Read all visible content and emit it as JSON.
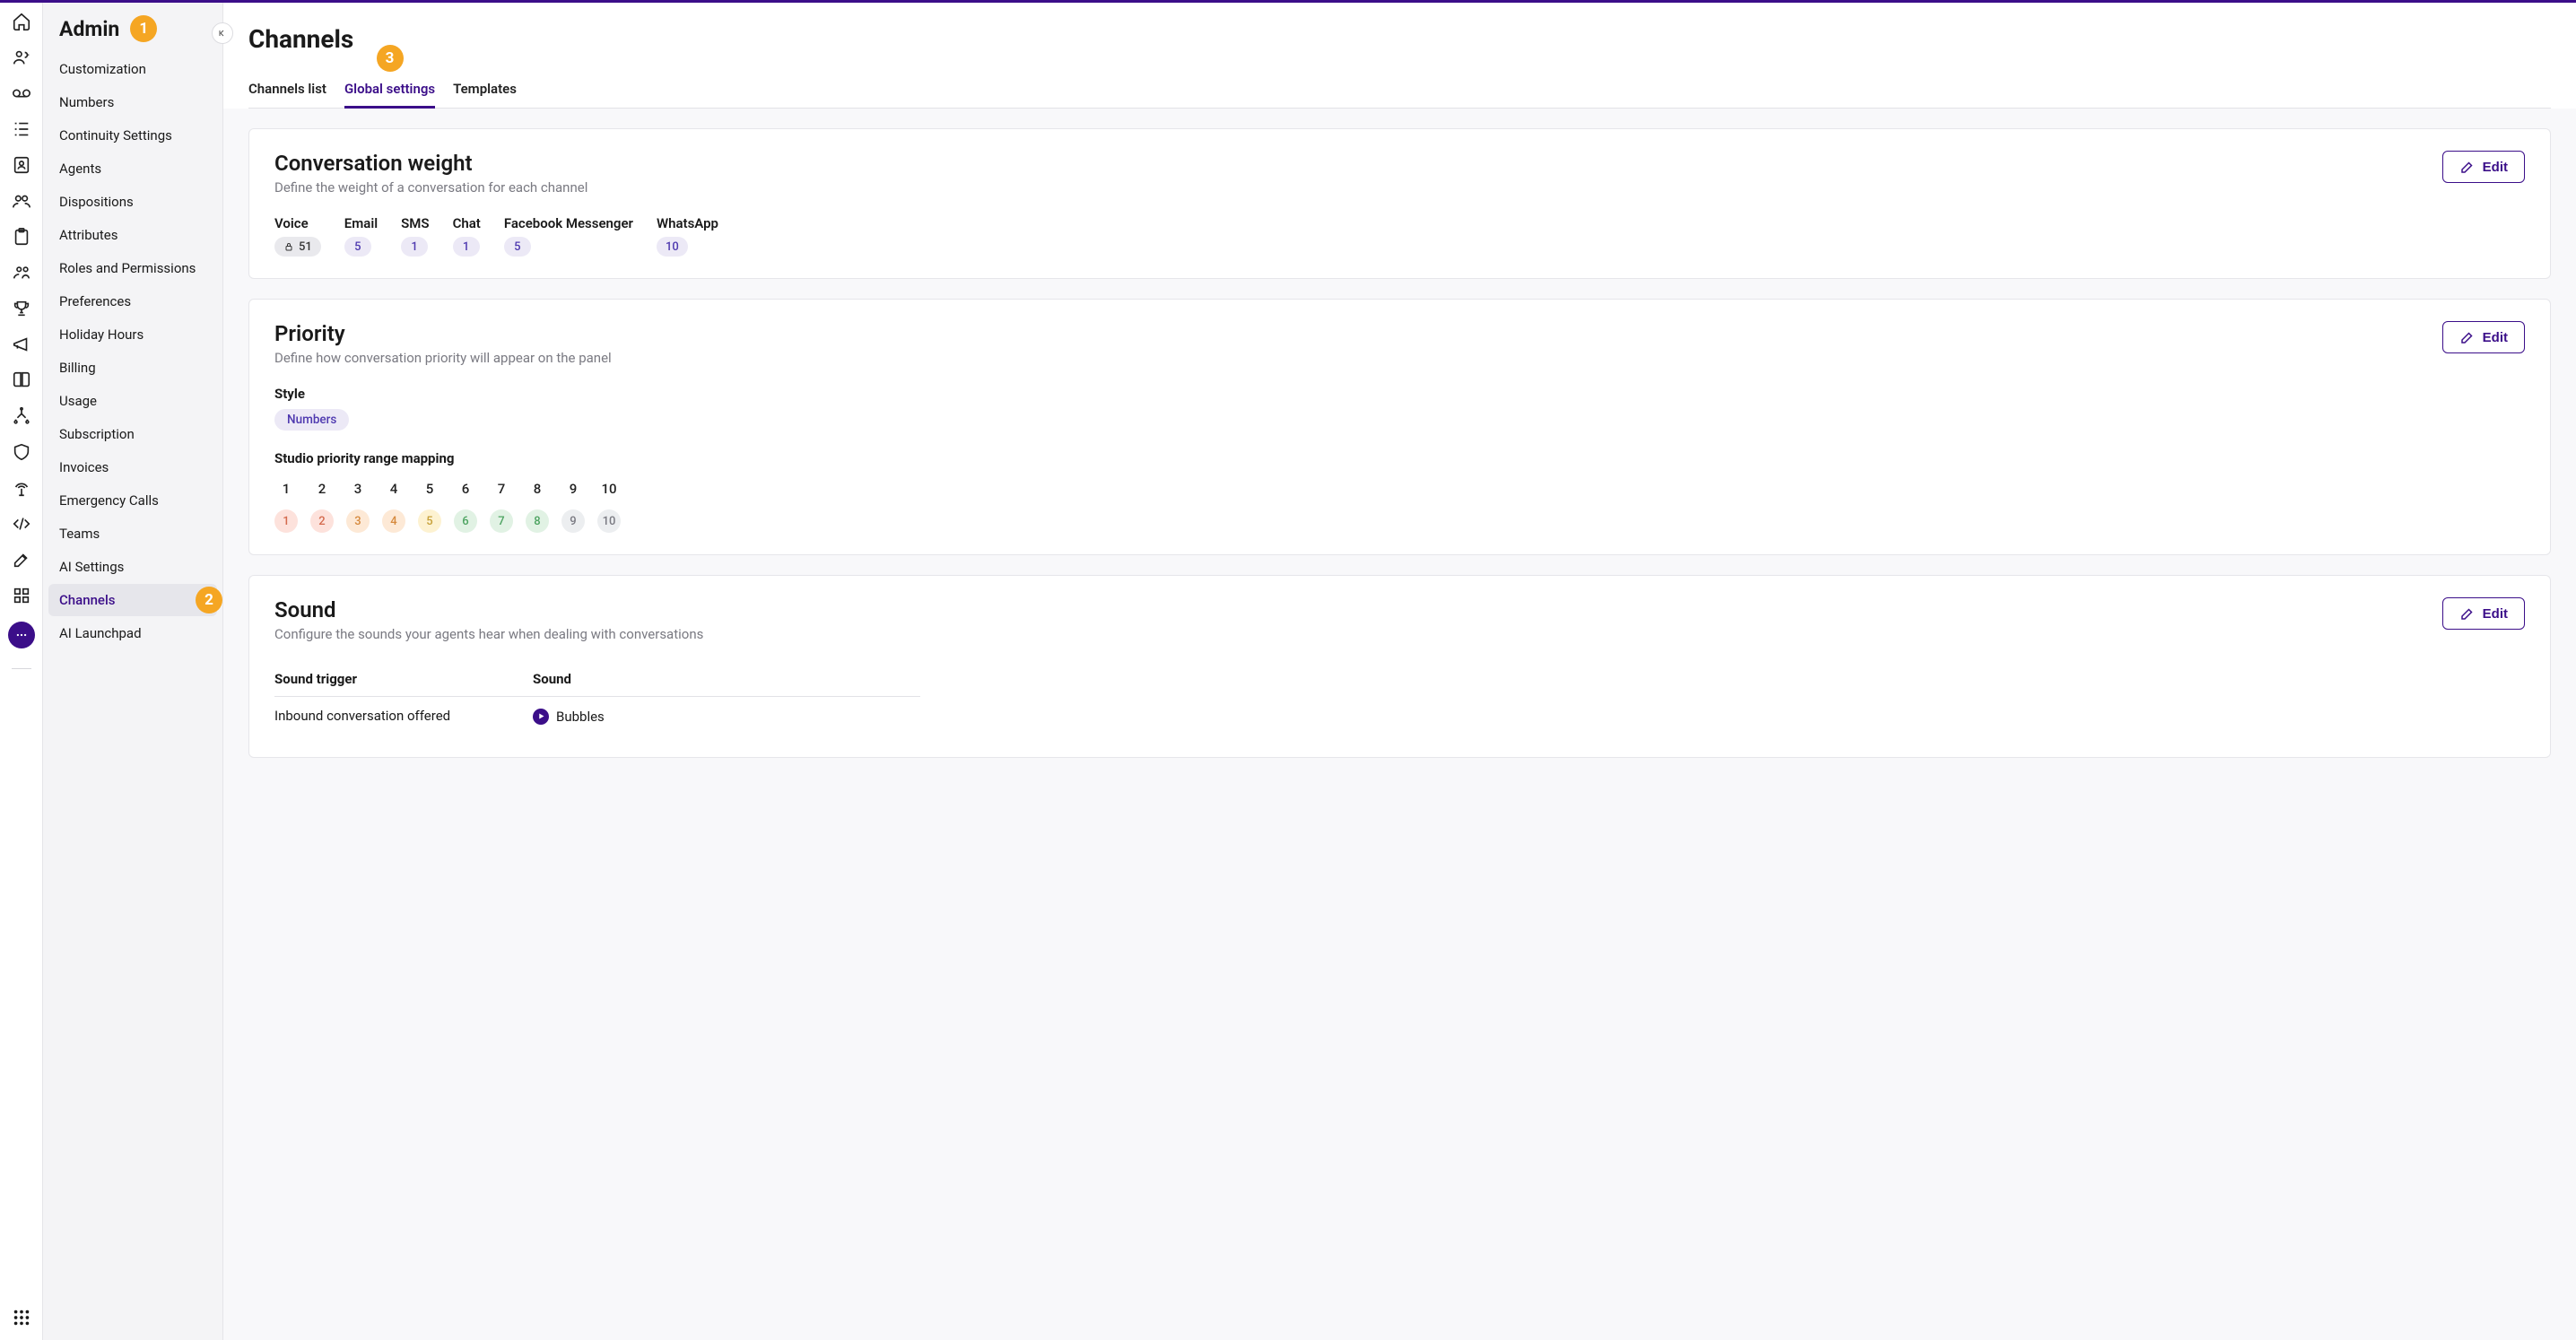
{
  "sidebar": {
    "title": "Admin",
    "items": [
      {
        "label": "Customization",
        "active": false
      },
      {
        "label": "Numbers",
        "active": false
      },
      {
        "label": "Continuity Settings",
        "active": false
      },
      {
        "label": "Agents",
        "active": false
      },
      {
        "label": "Dispositions",
        "active": false
      },
      {
        "label": "Attributes",
        "active": false
      },
      {
        "label": "Roles and Permissions",
        "active": false
      },
      {
        "label": "Preferences",
        "active": false
      },
      {
        "label": "Holiday Hours",
        "active": false
      },
      {
        "label": "Billing",
        "active": false
      },
      {
        "label": "Usage",
        "active": false
      },
      {
        "label": "Subscription",
        "active": false
      },
      {
        "label": "Invoices",
        "active": false
      },
      {
        "label": "Emergency Calls",
        "active": false
      },
      {
        "label": "Teams",
        "active": false
      },
      {
        "label": "AI Settings",
        "active": false
      },
      {
        "label": "Channels",
        "active": true
      },
      {
        "label": "AI Launchpad",
        "active": false
      }
    ]
  },
  "page": {
    "title": "Channels",
    "tabs": [
      {
        "label": "Channels list",
        "active": false
      },
      {
        "label": "Global settings",
        "active": true
      },
      {
        "label": "Templates",
        "active": false
      }
    ]
  },
  "convWeight": {
    "title": "Conversation weight",
    "subtitle": "Define the weight of a conversation for each channel",
    "editLabel": "Edit",
    "channels": [
      {
        "name": "Voice",
        "value": "51",
        "locked": true
      },
      {
        "name": "Email",
        "value": "5",
        "locked": false
      },
      {
        "name": "SMS",
        "value": "1",
        "locked": false
      },
      {
        "name": "Chat",
        "value": "1",
        "locked": false
      },
      {
        "name": "Facebook Messenger",
        "value": "5",
        "locked": false
      },
      {
        "name": "WhatsApp",
        "value": "10",
        "locked": false
      }
    ]
  },
  "priority": {
    "title": "Priority",
    "subtitle": "Define how conversation priority will appear on the panel",
    "editLabel": "Edit",
    "styleLabel": "Style",
    "styleValue": "Numbers",
    "mappingLabel": "Studio priority range mapping",
    "heads": [
      "1",
      "2",
      "3",
      "4",
      "5",
      "6",
      "7",
      "8",
      "9",
      "10"
    ],
    "cells": [
      {
        "v": "1",
        "bg": "#fde2dc",
        "fg": "#d46a4e"
      },
      {
        "v": "2",
        "bg": "#fde2dc",
        "fg": "#d46a4e"
      },
      {
        "v": "3",
        "bg": "#fde9d6",
        "fg": "#d68a3e"
      },
      {
        "v": "4",
        "bg": "#fde9d6",
        "fg": "#d68a3e"
      },
      {
        "v": "5",
        "bg": "#fdf2d1",
        "fg": "#c7a13a"
      },
      {
        "v": "6",
        "bg": "#e1f2e4",
        "fg": "#4ea462"
      },
      {
        "v": "7",
        "bg": "#e1f2e4",
        "fg": "#4ea462"
      },
      {
        "v": "8",
        "bg": "#e1f2e4",
        "fg": "#4ea462"
      },
      {
        "v": "9",
        "bg": "#eceef0",
        "fg": "#7a7a82"
      },
      {
        "v": "10",
        "bg": "#eceef0",
        "fg": "#7a7a82"
      }
    ]
  },
  "sound": {
    "title": "Sound",
    "subtitle": "Configure the sounds your agents hear when dealing with conversations",
    "editLabel": "Edit",
    "col1": "Sound trigger",
    "col2": "Sound",
    "rows": [
      {
        "trigger": "Inbound conversation offered",
        "sound": "Bubbles"
      }
    ]
  },
  "annotations": {
    "a1": "1",
    "a2": "2",
    "a3": "3"
  }
}
